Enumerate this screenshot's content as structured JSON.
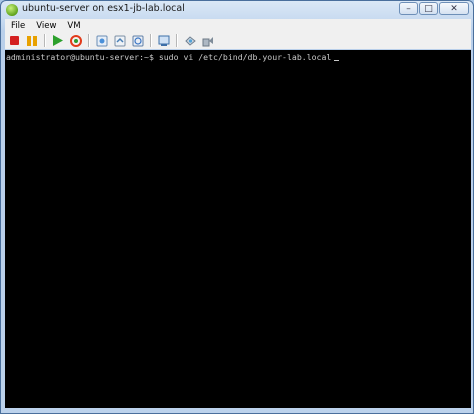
{
  "window": {
    "title": "ubuntu-server on esx1-jb-lab.local",
    "controls": {
      "minimize": "–",
      "maximize": "□",
      "close": "✕"
    }
  },
  "menu": {
    "items": [
      {
        "label": "File"
      },
      {
        "label": "View"
      },
      {
        "label": "VM"
      }
    ]
  },
  "toolbar": {
    "buttons": [
      "power-off",
      "suspend",
      "power-on",
      "reset",
      "snapshot",
      "revert-snapshot",
      "snapshot-manager",
      "console-options",
      "vm-settings",
      "connect-devices"
    ]
  },
  "console": {
    "prompt": "administrator@ubuntu-server:~$",
    "command": " sudo vi /etc/bind/db.your-lab.local"
  },
  "colors": {
    "console_bg": "#000000",
    "console_text": "#c8c8c8",
    "title_gradient_top": "#dbe8f6",
    "menubar_bg": "#f0f0f0"
  }
}
